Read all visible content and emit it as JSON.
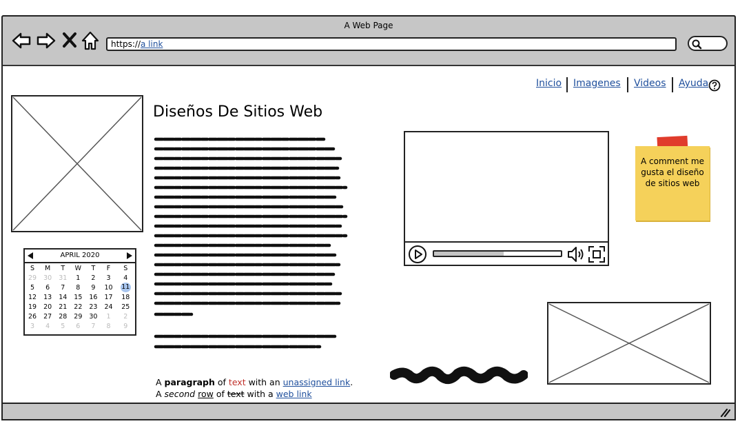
{
  "window": {
    "title": "A Web Page"
  },
  "address_bar": {
    "prefix": "https://",
    "link_text": "a link"
  },
  "nav": {
    "items": [
      {
        "label": "Inicio"
      },
      {
        "label": "Imagenes"
      },
      {
        "label": "Videos"
      },
      {
        "label": "Ayuda"
      }
    ]
  },
  "main": {
    "heading": "Diseños De Sitios Web"
  },
  "calendar": {
    "month_label": "APRIL 2020",
    "weekdays": [
      "S",
      "M",
      "T",
      "W",
      "T",
      "F",
      "S"
    ],
    "rows": [
      [
        "29",
        "30",
        "31",
        "1",
        "2",
        "3",
        "4"
      ],
      [
        "5",
        "6",
        "7",
        "8",
        "9",
        "10",
        "11"
      ],
      [
        "12",
        "13",
        "14",
        "15",
        "16",
        "17",
        "18"
      ],
      [
        "19",
        "20",
        "21",
        "22",
        "23",
        "24",
        "25"
      ],
      [
        "26",
        "27",
        "28",
        "29",
        "30",
        "1",
        "2"
      ],
      [
        "3",
        "4",
        "5",
        "6",
        "7",
        "8",
        "9"
      ]
    ],
    "selected": "11"
  },
  "paragraph": {
    "line1": {
      "a": "A ",
      "bold": "paragraph",
      "b": " of ",
      "red": "text",
      "c": " with an ",
      "link": "unassigned link",
      "d": "."
    },
    "line2": {
      "a": "A ",
      "italic": "second",
      "b": " ",
      "underline": "row",
      "c": " of ",
      "strike": "text",
      "d": " with a ",
      "link": "web link"
    }
  },
  "sticky_note": {
    "text": "A comment me gusta el diseño de sitios web"
  },
  "video": {
    "progress": 0.55
  },
  "icons": [
    "back-icon",
    "forward-icon",
    "close-icon",
    "home-icon",
    "search-icon",
    "help-icon",
    "play-icon",
    "volume-icon",
    "fullscreen-icon",
    "resize-grip-icon",
    "image-placeholder-icon"
  ]
}
